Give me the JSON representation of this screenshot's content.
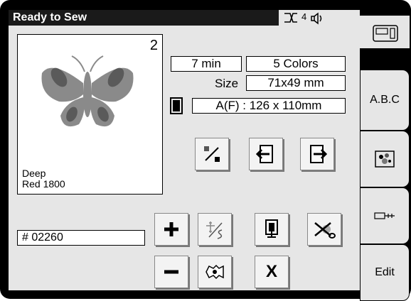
{
  "status": {
    "title": "Ready to Sew",
    "needle_number": "4"
  },
  "preview": {
    "count": "2",
    "thread_line1": "Deep",
    "thread_line2": "Red 1800"
  },
  "info": {
    "time": "7 min",
    "colors": "5 Colors",
    "size_label": "Size",
    "size_value": "71x49 mm",
    "hoop_value": "A(F) : 126 x 110mm"
  },
  "id_field": {
    "value": "# 02260"
  },
  "buttons": {
    "cancel": "X"
  },
  "tabs": {
    "abc": "A.B.C",
    "edit": "Edit"
  },
  "icons": [
    "machine-icon",
    "needle-icon",
    "speaker-icon",
    "hoop-icon",
    "trial-icon",
    "left-arrow-icon",
    "right-arrow-icon",
    "plus-icon",
    "minus-icon",
    "stitch-icon",
    "bobbin-icon",
    "scissors-icon",
    "gear-icon",
    "embroidery-icon",
    "usb-icon"
  ],
  "colors": {
    "screen": "#e6e6e6",
    "butterfly_wing": "#8a8a8a",
    "butterfly_spot": "#5a5a5a"
  }
}
